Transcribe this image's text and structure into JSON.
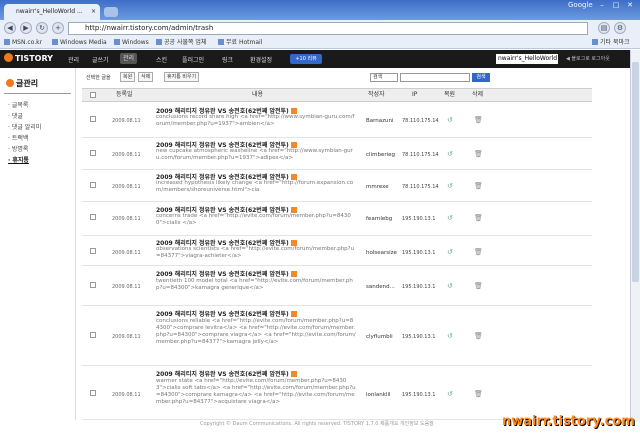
{
  "browser": {
    "tab_title": "nwairr's_HelloWorld ...",
    "google_label": "Google",
    "url": "http://nwairr.tistory.com/admin/trash",
    "bookmarks": [
      "MSN.co.kr",
      "Windows Media",
      "Windows",
      "공공 사물쪽 업체",
      "무료 Hotmail"
    ],
    "other_bookmarks": "기타 북마크"
  },
  "topnav": {
    "logo": "TISTORY",
    "menus": [
      "관리",
      "글쓰기",
      "관리",
      "스킨",
      "플러그인",
      "링크",
      "환경설정"
    ],
    "active_index": 2,
    "pill": "+10 리뷰",
    "blog_select": "nwairr's_HelloWorld",
    "links": "◀ 블로그로   로그아웃"
  },
  "sidebar": {
    "title": "글관리",
    "items": [
      "글목록",
      "댓글",
      "댓글 알리미",
      "트랙백",
      "방명록",
      "휴지통"
    ],
    "current_index": 5
  },
  "toolbar": {
    "selected_label": "선택한 글을",
    "restore": "복원",
    "delete": "삭제",
    "empty": "휴지통 비우기",
    "search_select": "검색",
    "search_button": "검색"
  },
  "table": {
    "headers": [
      "등록일",
      "내용",
      "작성자",
      "IP",
      "복원",
      "삭제"
    ],
    "rows": [
      {
        "date": "2009.08.11",
        "title": "2009 해리티지 정유완 VS 송전호(62번째 암전투)",
        "body": "conclusions record share high <a href=\"http://www.symbian-guru.com/forum/member.php?u=1937\">ambien</a>",
        "author": "Barnazuni",
        "ip": "78.110.175.14"
      },
      {
        "date": "2009.08.11",
        "title": "2009 해리티지 정유완 VS 송전호(62번째 암전투)",
        "body": "new cupcake atmospheric washeline <a href=\"http://www.symbian-guru.com/forum/member.php?u=1937\">adipex</a>",
        "author": "climberieg",
        "ip": "78.110.175.14"
      },
      {
        "date": "2009.08.11",
        "title": "2009 해리티지 정유완 VS 송전호(62번째 암전투)",
        "body": "increased hypothesis likely change <a href=\"http://forum.expansion.com/members/shoreuniverse.html\">cia",
        "author": "mmrexe",
        "ip": "78.110.175.14"
      },
      {
        "date": "2009.08.11",
        "title": "2009 해리티지 정유완 VS 송전호(62번째 암전투)",
        "body": "concerns trade <a href=\"http://evite.com/forum/member.php?u=84300\">cialis </a>",
        "author": "fearnlebg",
        "ip": "195.190.13.1"
      },
      {
        "date": "2009.08.11",
        "title": "2009 해리티지 정유완 VS 송전호(62번째 암전투)",
        "body": "observations scientists <a href=\"http://evite.com/forum/member.php?u=84377\">viagra-achieter</a>",
        "author": "holsearsize",
        "ip": "195.190.13.1"
      },
      {
        "date": "2009.08.11",
        "title": "2009 해리티지 정유완 VS 송전호(62번째 암전투)",
        "body": "twentieth 100 model total <a href=\"http://evite.com/forum/member.php?u=84300\">kamagra generique</a>",
        "author": "sandend...",
        "ip": "195.190.13.1"
      },
      {
        "date": "2009.08.11",
        "title": "2009 해리티지 정유완 VS 송전호(62번째 암전투)",
        "body": "conclusions reliable <a href=\"http://evite.com/forum/member.php?u=84300\">comprare levitra</a> <a href=\"http://evite.com/forum/member.php?u=84300\">comprare viagra</a> <a href=\"http://evite.com/forum/member.php?u=84377\">kamagra jelly</a>",
        "author": "clyflumbli",
        "ip": "195.190.13.1"
      },
      {
        "date": "2009.08.11",
        "title": "2009 해리티지 정유완 VS 송전호(62번째 암전투)",
        "body": "warmer state <a href=\"http://evite.com/forum/member.php?u=84303\">cialis soft tabs</a> <a href=\"http://evite.com/forum/member.php?u=84300\">comprare kamagra</a> <a href=\"http://evite.com/forum/member.php?u=84377\">acquistare viagra</a>",
        "author": "lonlanklil",
        "ip": "195.190.13.1"
      }
    ]
  },
  "footer": "Copyright © Daum Communications. All rights reserved. TISTORY 1.7.0   제품개요   개인정보   도움말",
  "watermark": "nwairr.tistory.com"
}
